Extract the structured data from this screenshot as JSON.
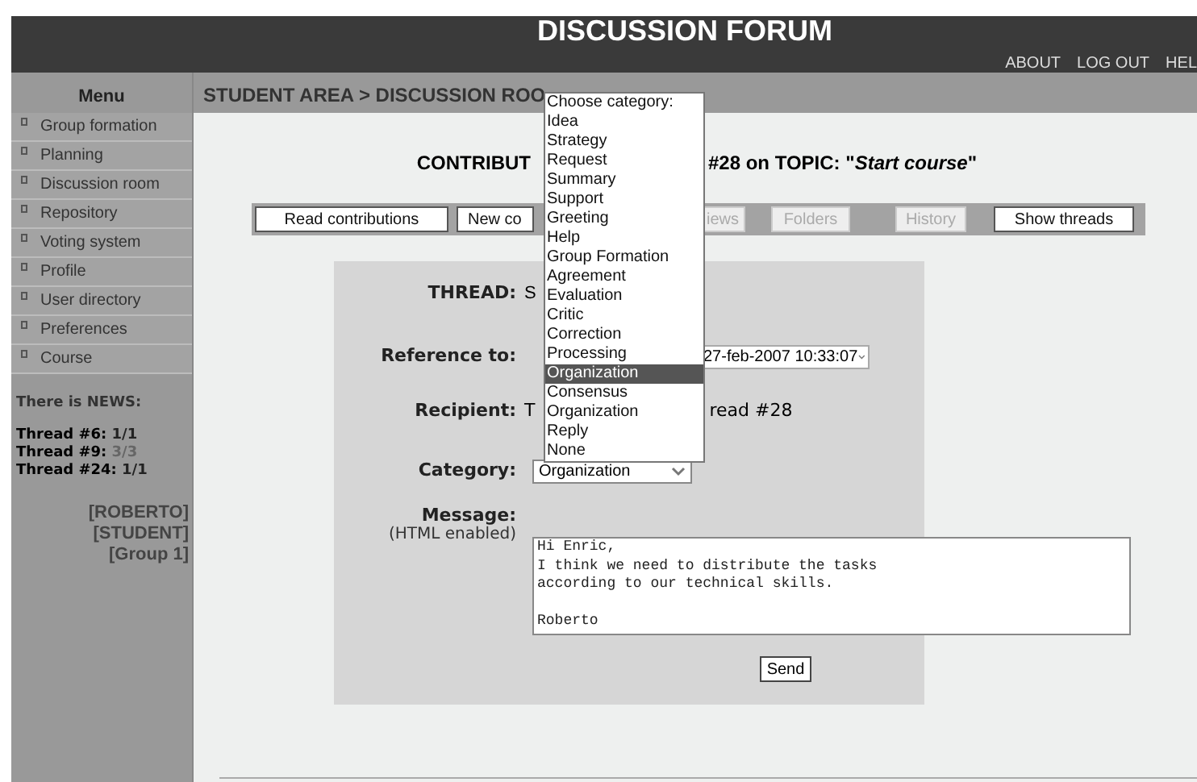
{
  "header": {
    "title": "DISCUSSION FORUM",
    "links": [
      "ABOUT",
      "LOG OUT",
      "HEL"
    ]
  },
  "sidebar": {
    "title": "Menu",
    "items": [
      {
        "label": "Group formation"
      },
      {
        "label": "Planning"
      },
      {
        "label": "Discussion room"
      },
      {
        "label": "Repository"
      },
      {
        "label": "Voting system"
      },
      {
        "label": "Profile"
      },
      {
        "label": "User directory"
      },
      {
        "label": "Preferences"
      },
      {
        "label": "Course"
      }
    ],
    "news_title": "There is NEWS:",
    "news": [
      {
        "label": "Thread #6:",
        "count": "1/1",
        "color": "#222222"
      },
      {
        "label": "Thread #9:",
        "count": "3/3",
        "color": "#666666"
      },
      {
        "label": "Thread #24:",
        "count": "1/1",
        "color": "#222222"
      }
    ],
    "user": [
      "[ROBERTO]",
      "[STUDENT]",
      "[Group 1]"
    ]
  },
  "breadcrumb": "STUDENT AREA > DISCUSSION ROO",
  "heading": {
    "left": "CONTRIBUT",
    "right": "#28 on TOPIC: \"*Start course*\""
  },
  "toolbar": [
    {
      "label": "Read contributions",
      "disabled": false
    },
    {
      "label": "New co",
      "disabled": false
    },
    {
      "label": "iews",
      "disabled": true
    },
    {
      "label": "Folders",
      "disabled": true
    },
    {
      "label": "History",
      "disabled": true
    },
    {
      "label": "Show threads",
      "disabled": false
    }
  ],
  "form": {
    "thread": {
      "label": "THREAD:",
      "value": "S"
    },
    "reference": {
      "label": "Reference to:",
      "value": "27-feb-2007 10:33:07"
    },
    "recipient": {
      "label": "Recipient:",
      "value_left": "T",
      "value_right": "read #28"
    },
    "category": {
      "label": "Category:",
      "value": "Organization"
    },
    "message": {
      "label": "Message:",
      "hint": "(HTML enabled)",
      "value": "Hi Enric,\nI think we need to distribute the tasks\naccording to our technical skills.\n\nRoberto"
    },
    "send": "Send"
  },
  "category_dropdown": [
    {
      "label": "Choose category:",
      "selected": false
    },
    {
      "label": "Idea",
      "selected": false
    },
    {
      "label": "Strategy",
      "selected": false
    },
    {
      "label": "Request",
      "selected": false
    },
    {
      "label": "Summary",
      "selected": false
    },
    {
      "label": "Support",
      "selected": false
    },
    {
      "label": "Greeting",
      "selected": false
    },
    {
      "label": "Help",
      "selected": false
    },
    {
      "label": "Group Formation",
      "selected": false
    },
    {
      "label": "Agreement",
      "selected": false
    },
    {
      "label": "Evaluation",
      "selected": false
    },
    {
      "label": "Critic",
      "selected": false
    },
    {
      "label": "Correction",
      "selected": false
    },
    {
      "label": "Processing",
      "selected": false
    },
    {
      "label": "Organization",
      "selected": true
    },
    {
      "label": "Consensus",
      "selected": false
    },
    {
      "label": "Organization",
      "selected": false
    },
    {
      "label": "Reply",
      "selected": false
    },
    {
      "label": "None",
      "selected": false
    }
  ]
}
